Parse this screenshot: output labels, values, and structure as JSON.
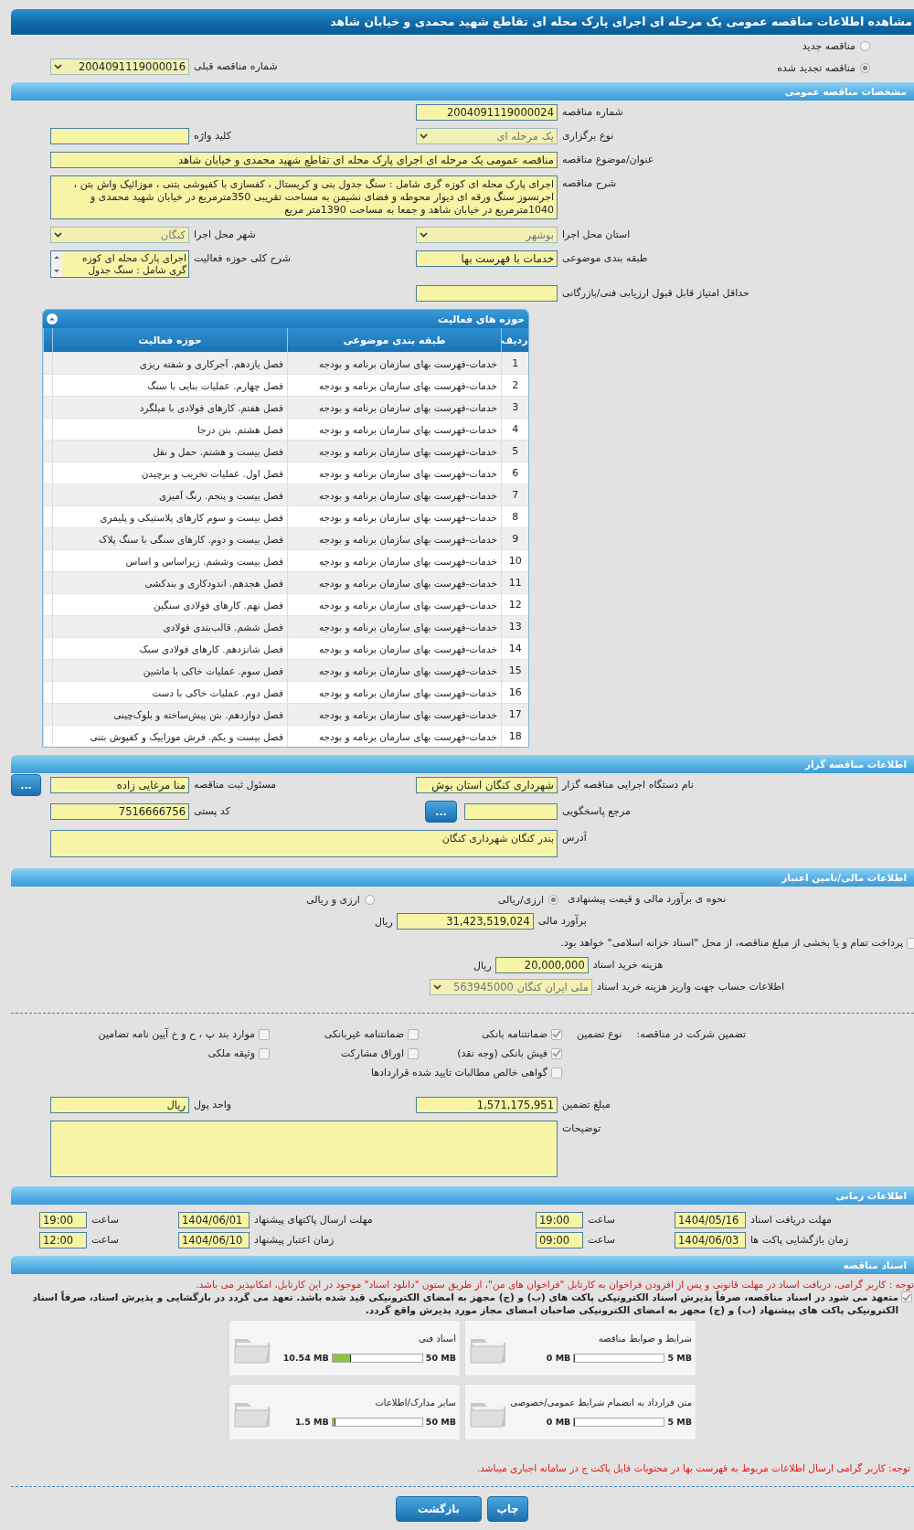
{
  "window": {
    "title": "مشاهده اطلاعات مناقصه عمومی یک مرحله ای اجرای پارک محله ای تقاطع شهید محمدی و خیابان شاهد"
  },
  "tender_type": [
    {
      "label": "مناقصه جدید",
      "selected": false
    },
    {
      "label": "مناقصه تجدید شده",
      "selected": true
    }
  ],
  "previous_tender": {
    "kind": "select",
    "label": "شماره مناقصه قبلی",
    "value": "2004091119000016",
    "disabled": false
  },
  "general": {
    "title": "مشخصات مناقصه عمومی",
    "rows": [
      [
        {
          "kind": "input",
          "label": "شماره مناقصه",
          "value": "2004091119000024"
        }
      ],
      [
        {
          "kind": "select",
          "label": "نوع برگزاری",
          "value": "یک مرحله ای",
          "disabled": true
        },
        {
          "kind": "input",
          "label": "کلید واژه"
        }
      ],
      [
        {
          "kind": "wide",
          "label": "عنوان/موضوع مناقصه",
          "value": "مناقصه عمومی یک مرحله ای اجرای پارک محله ای تقاطع شهید محمدی و خیابان شاهد"
        }
      ],
      [
        {
          "kind": "textarea",
          "label": "شرح مناقصه",
          "value": "اجرای پارک محله ای کوزه گری شامل : سنگ جدول بنی و کریستال ، کفسازی با کفپوشی بتنی ، موزائیک واش بتن ، اجرنسوز سنگ ورقه ای دیوار محوطه و فضای نشیمن به مساحت تقریبی 350مترمربع در خیابان شهید محمدی و 1040مترمربع در خیابان شاهد و جمعا به مساحت 1390متر مربع"
        }
      ],
      [
        {
          "kind": "select",
          "label": "استان محل اجرا",
          "value": "بوشهر",
          "disabled": true
        },
        {
          "kind": "select",
          "label": "شهر محل اجرا",
          "value": "کنگان",
          "disabled": true
        }
      ],
      [
        {
          "kind": "input",
          "label": "طبقه بندی موضوعی",
          "value": "خدمات با فهرست بها"
        },
        {
          "kind": "memo",
          "label": "شرح کلی حوزه فعالیت",
          "value": "اجرای پارک محله ای کوزه گری شامل : سنگ جدول"
        }
      ],
      [
        {
          "kind": "input",
          "label": "حداقل امتیاز قابل قبول ارزیابی فنی/بازرگانی"
        }
      ]
    ]
  },
  "activities": {
    "title": "حوزه های فعالیت",
    "columns": [
      "ردیف",
      "طبقه بندی موضوعی",
      "حوزه فعالیت"
    ],
    "rows": [
      [
        "1",
        "خدمات-فهرست بهای سازمان برنامه و بودجه",
        "فصل یازدهم. آجرکاری و شفته ریزی"
      ],
      [
        "2",
        "خدمات-فهرست بهای سازمان برنامه و بودجه",
        "فصل چهارم. عملیات بنایی با سنگ"
      ],
      [
        "3",
        "خدمات-فهرست بهای سازمان برنامه و بودجه",
        "فصل هفتم. کارهای فولادی با میلگرد"
      ],
      [
        "4",
        "خدمات-فهرست بهای سازمان برنامه و بودجه",
        "فصل هشتم. بتن درجا"
      ],
      [
        "5",
        "خدمات-فهرست بهای سازمان برنامه و بودجه",
        "فصل بیست و هشتم. حمل و نقل"
      ],
      [
        "6",
        "خدمات-فهرست بهای سازمان برنامه و بودجه",
        "فصل اول. عملیات تخریب و برچیدن"
      ],
      [
        "7",
        "خدمات-فهرست بهای سازمان برنامه و بودجه",
        "فصل بیست و پنجم. رنگ آمیزی"
      ],
      [
        "8",
        "خدمات-فهرست بهای سازمان برنامه و بودجه",
        "فصل بیست و سوم کارهای پلاستیکی و پلیمری"
      ],
      [
        "9",
        "خدمات-فهرست بهای سازمان برنامه و بودجه",
        "فصل بیست و دوم. کارهای سنگی با سنگ پلاک"
      ],
      [
        "10",
        "خدمات-فهرست بهای سازمان برنامه و بودجه",
        "فصل بیست وششم. زیراساس و اساس"
      ],
      [
        "11",
        "خدمات-فهرست بهای سازمان برنامه و بودجه",
        "فصل هجدهم. اندودکاری و بندکشی"
      ],
      [
        "12",
        "خدمات-فهرست بهای سازمان برنامه و بودجه",
        "فصل نهم. کارهای فولادی سنگین"
      ],
      [
        "13",
        "خدمات-فهرست بهای سازمان برنامه و بودجه",
        "فصل ششم. قالب‌بندی فولادی"
      ],
      [
        "14",
        "خدمات-فهرست بهای سازمان برنامه و بودجه",
        "فصل شانزدهم. کارهای فولادی سبک"
      ],
      [
        "15",
        "خدمات-فهرست بهای سازمان برنامه و بودجه",
        "فصل سوم. عملیات خاکی با ماشین"
      ],
      [
        "16",
        "خدمات-فهرست بهای سازمان برنامه و بودجه",
        "فصل دوم. عملیات خاکی با دست"
      ],
      [
        "17",
        "خدمات-فهرست بهای سازمان برنامه و بودجه",
        "فصل دوازدهم. بتن پیش‌ساخته و بلوک‌چینی"
      ],
      [
        "18",
        "خدمات-فهرست بهای سازمان برنامه و بودجه",
        "فصل بیست و یکم. فرش موزاییک و کفپوش بتنی"
      ]
    ]
  },
  "organizer": {
    "title": "اطلاعات مناقصه گزار",
    "rows": [
      [
        {
          "kind": "input",
          "label": "نام دستگاه اجرایی مناقصه گزار",
          "value": "شهرداری کنگان استان بوش"
        },
        {
          "kind": "input",
          "label": "مسئول ثبت مناقصه",
          "value": "منا مرغایی زاده",
          "button": "..."
        }
      ],
      [
        {
          "kind": "input",
          "label": "مرجع پاسخگویی",
          "button": "..."
        },
        {
          "kind": "input",
          "label": "کد پستی",
          "value": "7516666756"
        }
      ],
      [
        {
          "kind": "textarea",
          "label": "آدرس",
          "value": "بندر کنگان شهرداری کنگان"
        }
      ]
    ]
  },
  "financial": {
    "title": "اطلاعات مالی/تامین اعتبار",
    "estimate_method": {
      "label": "نحوه ی برآورد مالی و قیمت پیشنهادی",
      "options": [
        {
          "label": "ارزی/ریالی",
          "selected": true
        },
        {
          "label": "ارزی و ریالی",
          "selected": false
        }
      ]
    },
    "estimate": {
      "label": "برآورد مالی",
      "value": "31,423,519,024",
      "unit": "ریال"
    },
    "treasury": {
      "label": "پرداخت تمام و یا بخشی از مبلغ مناقصه، از محل \"اسناد خزانه اسلامی\" خواهد بود.",
      "checked": false
    },
    "doc_fee": {
      "label": "هزینه خرید اسناد",
      "value": "20,000,000",
      "unit": "ریال"
    },
    "account": {
      "label": "اطلاعات حساب جهت واریز هزینه خرید اسناد",
      "value": "ملی ایران کنگان 563945000",
      "disabled": true
    }
  },
  "guarantee": {
    "label": "تضمین شرکت در مناقصه:",
    "type_label": "نوع تضمین",
    "options": [
      {
        "label": "ضمانتنامه بانکی",
        "checked": true
      },
      {
        "label": "ضمانتنامه غیربانکی",
        "checked": false
      },
      {
        "label": "موارد بند پ ، ح و خ آیین نامه تضامین",
        "checked": false
      },
      {
        "label": "فیش بانکی (وجه نقد)",
        "checked": true
      },
      {
        "label": "اوراق مشارکت",
        "checked": false
      },
      {
        "label": "وثیقه ملکی",
        "checked": false
      },
      {
        "label": "گواهی خالص مطالبات تایید شده قراردادها",
        "checked": false
      }
    ],
    "rows": [
      [
        {
          "kind": "input",
          "label": "مبلغ تضمین",
          "value": "1,571,175,951"
        },
        {
          "kind": "input",
          "label": "واحد پول",
          "value": "ریال"
        }
      ],
      [
        {
          "kind": "notes",
          "label": "توضیحات"
        }
      ]
    ]
  },
  "timing": {
    "title": "اطلاعات زمانی",
    "rows": [
      [
        {
          "label": "مهلت دریافت اسناد",
          "value": "1404/05/16"
        },
        {
          "label": "ساعت",
          "value": "19:00"
        },
        {
          "label": "مهلت ارسال پاکتهای پیشنهاد",
          "value": "1404/06/01"
        },
        {
          "label": "ساعت",
          "value": "19:00"
        }
      ],
      [
        {
          "label": "زمان بازگشایی پاکت ها",
          "value": "1404/06/03"
        },
        {
          "label": "ساعت",
          "value": "09:00"
        },
        {
          "label": "زمان اعتبار پیشنهاد",
          "value": "1404/06/10"
        },
        {
          "label": "ساعت",
          "value": "12:00"
        }
      ]
    ]
  },
  "documents": {
    "title": "اسناد مناقصه",
    "notice": "توجه : کاربر گرامی، دریافت اسناد در مهلت قانونی و پس از افزودن فراخوان به کارتابل \"فراخوان های من\"، از طریق ستون \"دانلود اسناد\" موجود در این کارتابل، امکانپذیر می باشد.",
    "commitment": {
      "text": "متعهد می شود در اسناد مناقصه، صرفاً پذیرش اسناد الکترونیکی پاکت های (ب) و (ج) مجهز به امضای الکترونیکی قید شده باشد. تعهد می گردد در بازگشایی و پذیرش اسناد، صرفاً اسناد الکترونیکی پاکت های پیشنهاد (ب) و (ج) مجهز به امضای الکترونیکی صاحبان امضای مجاز مورد پذیرش واقع گردد.",
      "checked": true
    },
    "files": [
      {
        "title": "شرایط و ضوابط مناقصه",
        "used": "0 MB",
        "max": "5 MB",
        "level": 0
      },
      {
        "title": "اسناد فنی",
        "used": "10.54 MB",
        "max": "50 MB",
        "level": 0.21
      },
      {
        "title": "متن قرارداد به انضمام شرایط عمومی/خصوصی",
        "used": "0 MB",
        "max": "5 MB",
        "level": 0
      },
      {
        "title": "سایر مدارک/اطلاعات",
        "used": "1.5 MB",
        "max": "50 MB",
        "level": 0.03
      }
    ],
    "note": "توجه: کاربر گرامی ارسال اطلاعات مربوط به فهرست بها در محتویات فایل پاکت ج در سامانه اجباری میباشد."
  },
  "buttons": [
    "چاپ",
    "بازگشت"
  ]
}
